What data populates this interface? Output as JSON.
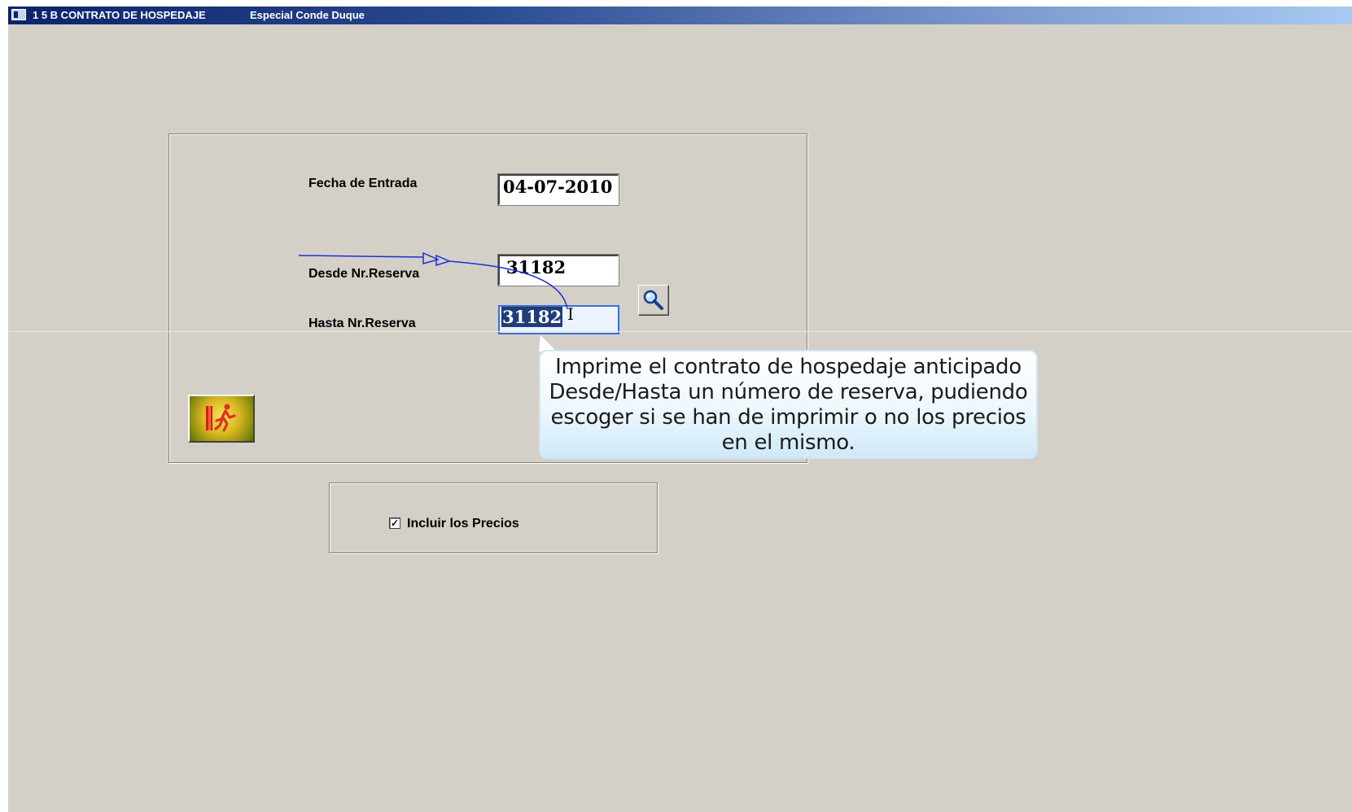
{
  "window": {
    "title": "1 5 B CONTRATO DE HOSPEDAJE",
    "subtitle": "Especial Conde Duque"
  },
  "form": {
    "fecha_entrada": {
      "label": "Fecha de Entrada",
      "value": "04-07-2010"
    },
    "desde_reserva": {
      "label": "Desde Nr.Reserva",
      "value": "31182"
    },
    "hasta_reserva": {
      "label": "Hasta Nr.Reserva",
      "value": "31182"
    }
  },
  "options": {
    "incluir_precios": {
      "label": "Incluir los Precios",
      "checked": true,
      "mark": "✓"
    }
  },
  "tooltip": {
    "text": "Imprime el contrato de hospedaje anticipado Desde/Hasta un número de reserva, pudiendo escoger si se han de imprimir o no los precios en el mismo."
  },
  "icons": {
    "search": "magnifier-icon",
    "exit": "exit-door-icon",
    "window": "app-window-icon"
  }
}
